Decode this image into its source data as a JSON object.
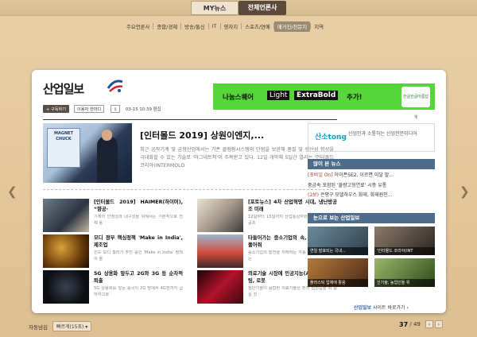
{
  "topnav": {
    "my_news": "MY뉴스",
    "all_press": "전체언론사"
  },
  "categories": [
    "주요언론사",
    "종합/경제",
    "방송/통신",
    "IT",
    "영자지",
    "스포츠/연예",
    "매거진/전문지",
    "지역"
  ],
  "active_category": "매거진/전문지",
  "paper": {
    "logo": "산업일보",
    "subscribe": "+ 구독하기",
    "contact": "이용자 한마디",
    "date": "03-15 10:39 편집",
    "ad": {
      "text1": "나눔스퀘어",
      "light": "Light",
      "extra": "ExtraBold",
      "text2": "추가!",
      "logo_text": "한글한글아름답게"
    },
    "main": {
      "img_text": "MAGNET CHUCK",
      "headline": "[인터몰드 2019] 상원이엔지,...",
      "lead": "최근 공작기계 및 금형산업에서는 기존 클램핑시스템의 단점을 보완해 품질 및 생산성 향상을 극대화할 수 있는 기술로 '마그네트척'이 주목받고 있다. 12일 개막해 5일간 열리는 '인터몰드 코리아(INTERMOLD"
    },
    "stories": [
      {
        "title": "[인터몰드 2019] HAIMER(하이머), “향공·",
        "desc": "기계의 안정성과 내구성을 위해서는 기본적으로 전체 용"
      },
      {
        "title": "[포토뉴스] 4차 산업혁명 시대, 냉난방공조 미래",
        "desc": "12일부터 15일까지 산업통상자원부 주최·한국냉동공조"
      },
      {
        "title": "모디 정부 핵심정책 'Make in India', 제조업",
        "desc": "인도 모디 총리가 추진 중인 'Make in India' 정책이 올"
      },
      {
        "title": "타들어가는 중소기업의 속, 규제혁신으로 풀어줘",
        "desc": "중소기업의 발전을 저해하는 각종 규제에 대해 정부는"
      },
      {
        "title": "5G 상용화 앞두고 2G와 3G 등 순차적 퇴출",
        "desc": "5G 상용화를 앞둔 중국이 2G 망에서 4G망까지 급하하고로"
      },
      {
        "title": "의료기술 시장에 인공지능(AI), 3D 프린팅, 로봇",
        "desc": "첨단기술이 융합된 의료기술은 환자 접점길을 위 충실 것"
      }
    ],
    "sidebar": {
      "stong_logo": "산소tong",
      "stong_text": "산업인과 소통하는 산업전문미디어",
      "popular_head": "많이 본 뉴스",
      "popular": [
        {
          "tag": "[포바일 On]",
          "text": " 아이폰SE2, 이르면 이달 발..."
        },
        {
          "tag": "",
          "text": "중금속 포함된 '물량고형연료' 시중 유통"
        },
        {
          "tag": "(2보)",
          "text": " 은평구 모델하우스 화재, 화재원인..."
        }
      ],
      "photo_head": "눈으로 보는 산업일보",
      "photos": [
        "연일 발표되는 국내...",
        "'인터몰드 코리아(INT",
        "플라스틱 업체에 활용",
        "신기술, 농업인들 위"
      ],
      "more": "산업일보",
      "more_suffix": " 사이트 바로가기 ›"
    }
  },
  "bottom": {
    "auto_label": "자동넘김",
    "speed": "빠르게(15초) ▾",
    "page_current": "37",
    "page_total": "/ 49"
  },
  "colors": {
    "accent": "#4f6b8a",
    "ad_green": "#56d63b",
    "wood": "#e4c89c"
  }
}
